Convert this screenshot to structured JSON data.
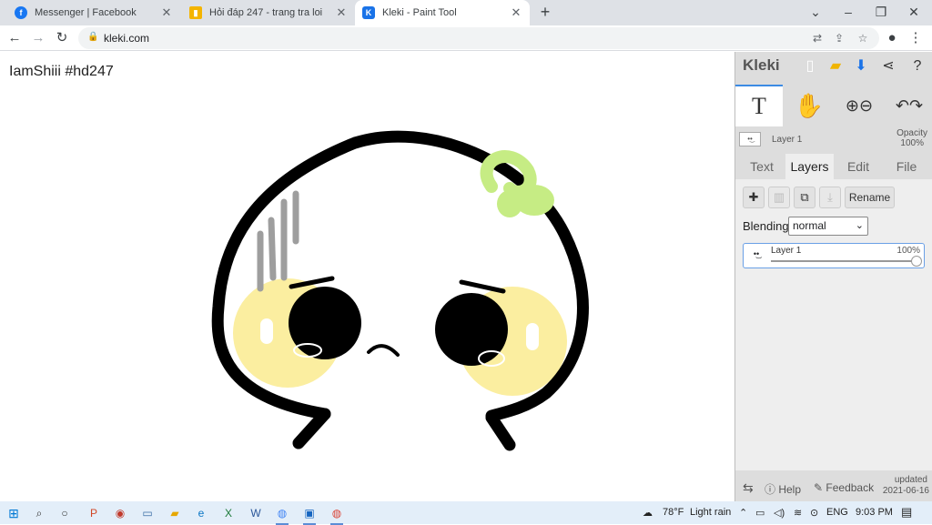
{
  "browser": {
    "tabs": [
      {
        "title": "Messenger | Facebook",
        "favicon": "facebook-icon",
        "color": "#1877f2",
        "active": false
      },
      {
        "title": "Hỏi đáp 247 - trang tra loi",
        "favicon": "chart-icon",
        "color": "#f4b400",
        "active": false
      },
      {
        "title": "Kleki - Paint Tool",
        "favicon": "kleki-icon",
        "color": "#1a73e8",
        "active": true
      }
    ],
    "url": "kleki.com"
  },
  "canvas": {
    "signature_text": "IamShiii #hd247"
  },
  "kleki": {
    "logo": "Kleki",
    "layer_info": {
      "name": "Layer 1",
      "opacity_label": "Opacity",
      "opacity_value": "100%"
    },
    "tabs": [
      "Text",
      "Layers",
      "Edit",
      "File"
    ],
    "active_tab": "Layers",
    "rename_label": "Rename",
    "blending_label": "Blending",
    "blending_value": "normal",
    "layers": [
      {
        "name": "Layer 1",
        "opacity": "100%"
      }
    ],
    "footer": {
      "help": "Help",
      "feedback": "Feedback",
      "updated_label": "updated",
      "updated_date": "2021-06-16"
    }
  },
  "taskbar": {
    "weather_temp": "78°F",
    "weather_text": "Light rain",
    "lang": "ENG",
    "time": "9:03 PM"
  },
  "colors": {
    "accent": "#1a73e8",
    "cheek": "#fbeea0",
    "bow": "#c6ec84",
    "stroke": "#000000",
    "sweat": "#9e9e9e"
  }
}
